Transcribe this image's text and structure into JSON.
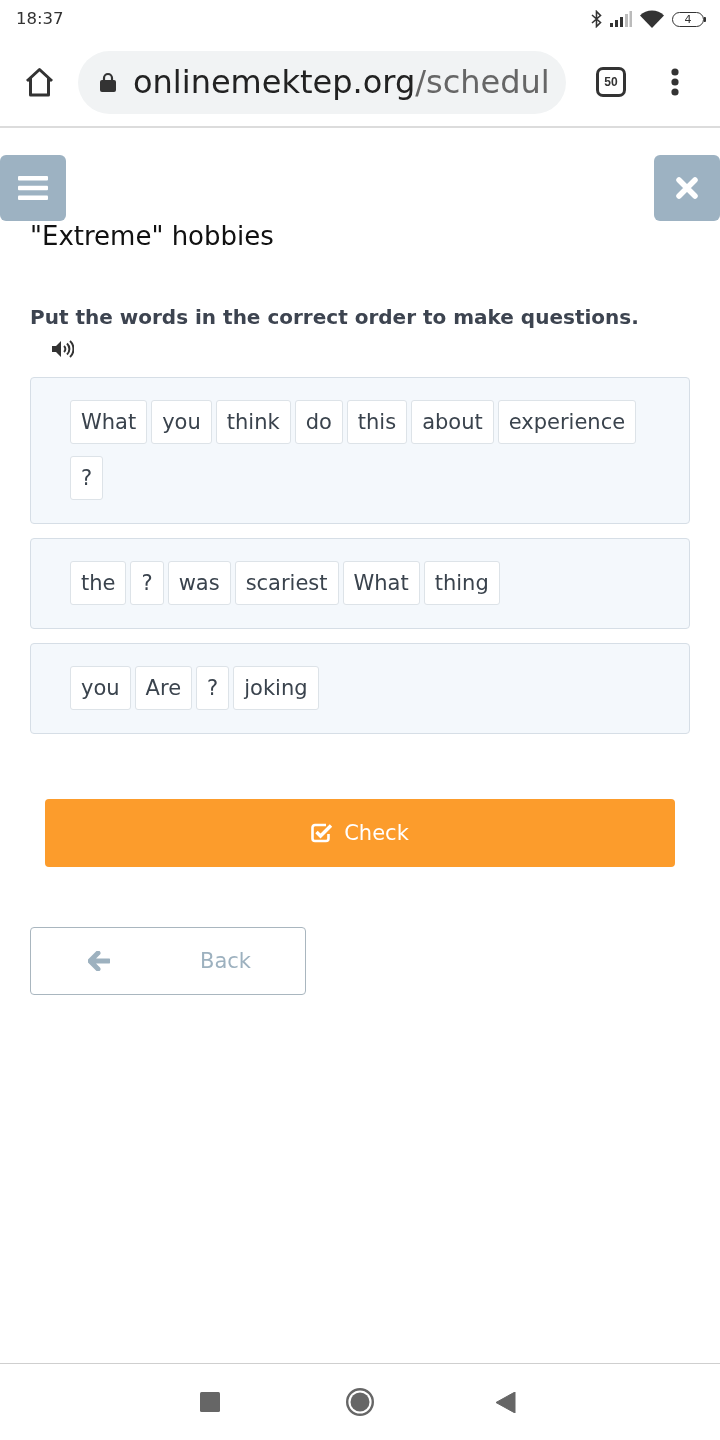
{
  "status_bar": {
    "time": "18:37",
    "battery": "4"
  },
  "browser": {
    "url_host": "onlinemektep.org",
    "url_path": "/schedul",
    "tab_count": "50"
  },
  "lesson": {
    "title": "\"Extreme\" hobbies"
  },
  "task": {
    "instruction": "Put the words in the correct order to make questions.",
    "sentences": [
      {
        "words": [
          "What",
          "you",
          "think",
          "do",
          "this",
          "about",
          "experience",
          "?"
        ]
      },
      {
        "words": [
          "the",
          "?",
          "was",
          "scariest",
          "What",
          "thing"
        ]
      },
      {
        "words": [
          "you",
          "Are",
          "?",
          "joking"
        ]
      }
    ]
  },
  "buttons": [
    {
      "kind": "primary",
      "label": "Check"
    },
    {
      "kind": "back",
      "label": "Back"
    }
  ]
}
